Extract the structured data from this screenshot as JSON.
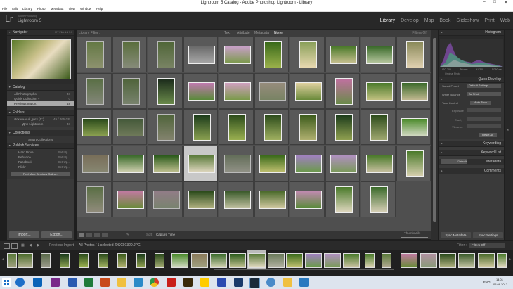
{
  "window": {
    "title": "Lightroom 5 Catalog - Adobe Photoshop Lightroom - Library",
    "min": "–",
    "max": "□",
    "close": "✕"
  },
  "menu": [
    "File",
    "Edit",
    "Library",
    "Photo",
    "Metadata",
    "View",
    "Window",
    "Help"
  ],
  "app": {
    "logo": "Lr",
    "vendor": "Adobe Photoshop",
    "name": "Lightroom 5"
  },
  "modules": {
    "library": "Library",
    "develop": "Develop",
    "map": "Map",
    "book": "Book",
    "slideshow": "Slideshow",
    "print": "Print",
    "web": "Web"
  },
  "left": {
    "navigator": {
      "title": "Navigator",
      "opts": "FIT  FILL  1:1  3:1"
    },
    "catalog": {
      "title": "Catalog",
      "items": [
        {
          "label": "All Photographs",
          "count": "48"
        },
        {
          "label": "Quick Collection +",
          "count": "0"
        },
        {
          "label": "Previous Import",
          "count": "48"
        }
      ]
    },
    "folders": {
      "title": "Folders",
      "volume": "Локальный диск (C:)",
      "volume_info": "49 / 465 GB",
      "folder": "Для Lightroom",
      "folder_count": "48"
    },
    "collections": {
      "title": "Collections",
      "item": "Smart Collections"
    },
    "publish": {
      "title": "Publish Services",
      "items": [
        {
          "label": "Hard Drive",
          "state": "Set Up..."
        },
        {
          "label": "Behance",
          "state": "Set Up..."
        },
        {
          "label": "Facebook",
          "state": "Set Up..."
        },
        {
          "label": "Flickr",
          "state": "Set Up..."
        }
      ],
      "find_more": "Find More Services Online..."
    },
    "import": "Import...",
    "export": "Export..."
  },
  "filter": {
    "title": "Library Filter :",
    "text": "Text",
    "attribute": "Attribute",
    "metadata": "Metadata",
    "none": "None",
    "filters_off": "Filters Off"
  },
  "toolbar": {
    "sort_label": "Sort:",
    "sort_value": "Capture Time",
    "thumbnails": "Thumbnails"
  },
  "right": {
    "histogram": {
      "title": "Histogram",
      "iso": "ISO 200",
      "focal": "50 mm",
      "aperture": "f / 2.0",
      "shutter": "1/250 sec",
      "original": "Original Photo"
    },
    "quick_develop": {
      "title": "Quick Develop",
      "saved_label": "Saved Preset",
      "saved_value": "Default Settings",
      "wb_label": "White Balance",
      "wb_value": "As Shot",
      "tone_label": "Tone Control",
      "tone_btn": "Auto Tone",
      "exposure": "Exposure",
      "clarity": "Clarity",
      "vibrance": "Vibrance",
      "reset": "Reset All"
    },
    "keywording": "Keywording",
    "keyword_list": "Keyword List",
    "metadata": "Metadata",
    "metadata_preset": "Default",
    "comments": "Comments",
    "sync_meta": "Sync Metadata",
    "sync_settings": "Sync Settings"
  },
  "filmstrip_bar": {
    "source": "Previous Import",
    "count": "All Photos / 1 selected /DSC01320.JPG",
    "filter_label": "Filter :",
    "filter_value": "Filters Off"
  },
  "taskbar": {
    "lang": "ENG",
    "time": "14:01",
    "date": "05.08.2017"
  }
}
